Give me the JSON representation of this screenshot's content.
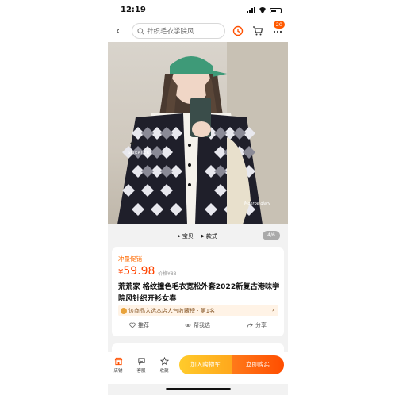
{
  "status_bar": {
    "time": "12:19"
  },
  "nav": {
    "search_placeholder": "针织毛衣学院风",
    "cart_badge": "20"
  },
  "gallery": {
    "overlay_heart": "❤",
    "overlay_text": "SWEATER",
    "overlay_signature": "Monroe diary",
    "tabs": [
      "宝贝",
      "款式"
    ],
    "page_indicator": "4/6"
  },
  "product": {
    "promo_label": "冲量促销",
    "price_symbol": "¥",
    "price_value": "59.98",
    "orig_label": "价格",
    "orig_price": "¥88",
    "title": "荒荒家 格纹撞色毛衣宽松外套2022新复古港味学院风针织开衫女春",
    "rank_text": "该商品入选本店人气收藏榜 · 第1名",
    "actions": [
      "推荐",
      "帮我选",
      "分享"
    ]
  },
  "bottom_bar": {
    "items": [
      "店铺",
      "客服",
      "收藏"
    ],
    "add_to_cart": "加入购物车",
    "buy_now": "立即购买"
  },
  "colors": {
    "accent": "#ff5000",
    "cart_button": "#ffb31f",
    "buy_button": "#ff5a0a"
  }
}
